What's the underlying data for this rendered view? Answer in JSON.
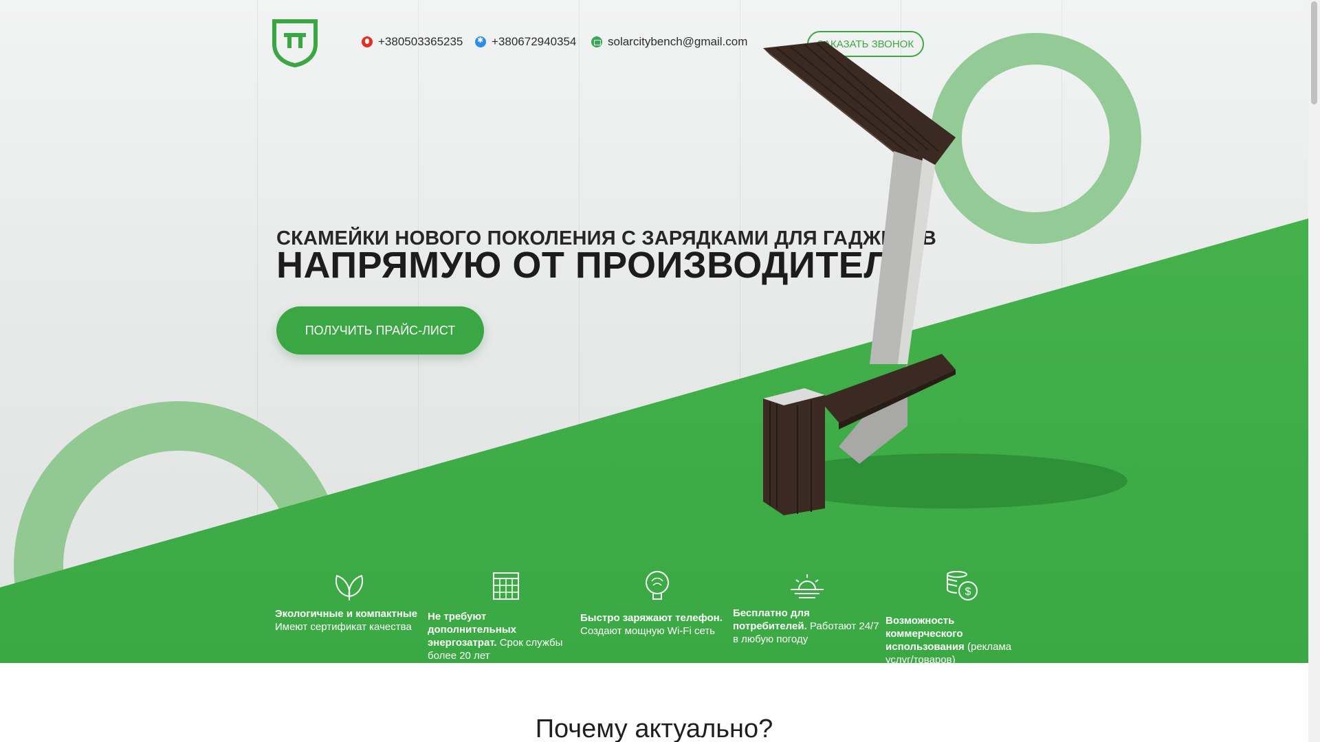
{
  "header": {
    "phone1": "+380503365235",
    "phone2": "+380672940354",
    "email": "solarcitybench@gmail.com",
    "callback_label": "ЗАКАЗАТЬ ЗВОНОК"
  },
  "hero": {
    "subtitle": "СКАМЕЙКИ НОВОГО ПОКОЛЕНИЯ С ЗАРЯДКАМИ ДЛЯ ГАДЖЕТОВ",
    "title": "НАПРЯМУЮ ОТ ПРОИЗВОДИТЕЛЯ",
    "cta_label": "ПОЛУЧИТЬ ПРАЙС-ЛИСТ"
  },
  "features": [
    {
      "icon": "leaves-icon",
      "bold": "Экологичные и компактные",
      "text": "Имеют сертификат качества"
    },
    {
      "icon": "calendar-icon",
      "bold": "Не требуют дополнительных энергозатрат.",
      "text": "Срок службы более 20 лет"
    },
    {
      "icon": "bulb-icon",
      "bold": "Быстро заряжают телефон.",
      "text": "Создают мощную Wi-Fi сеть"
    },
    {
      "icon": "sunrise-icon",
      "bold": "Бесплатно для потребителей.",
      "text": "Работают 24/7 в любую погоду"
    },
    {
      "icon": "coins-icon",
      "bold": "Возможность коммерческого использования",
      "text": "(реклама услуг/товаров)"
    }
  ],
  "section2": {
    "title": "Почему актуально?"
  },
  "colors": {
    "accent": "#3ba744",
    "ring": "#92c993",
    "text_dark": "#1c1c1c"
  }
}
